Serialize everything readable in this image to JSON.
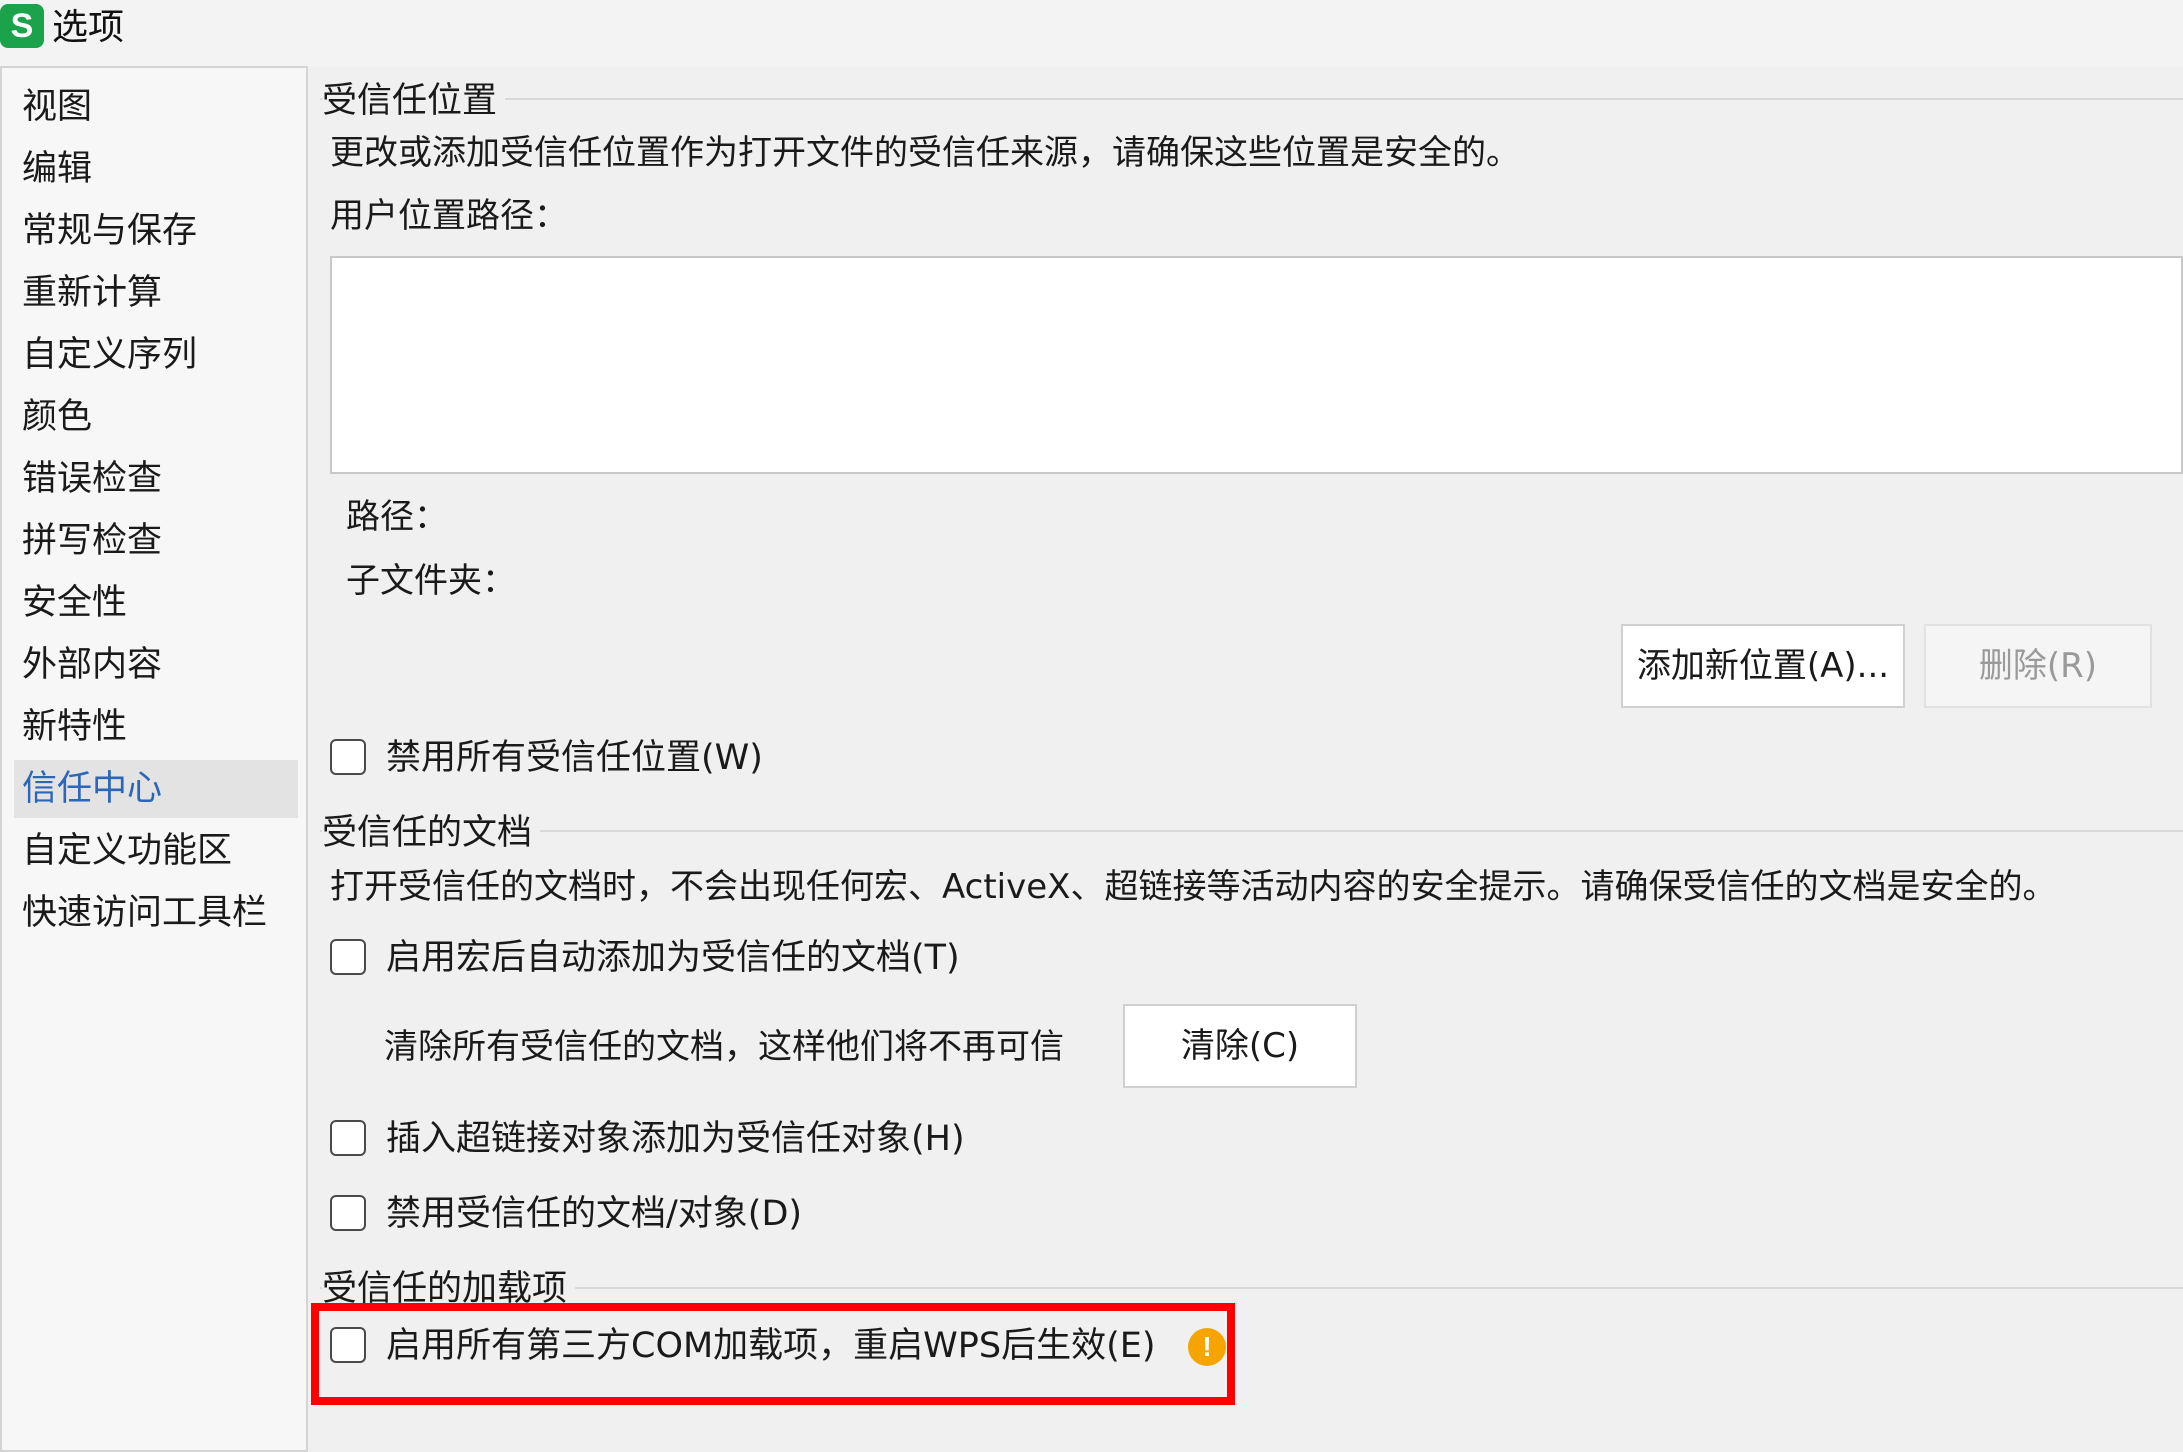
{
  "window": {
    "title": "选项",
    "logo_letter": "S"
  },
  "sidebar": {
    "items": [
      {
        "label": "视图"
      },
      {
        "label": "编辑"
      },
      {
        "label": "常规与保存"
      },
      {
        "label": "重新计算"
      },
      {
        "label": "自定义序列"
      },
      {
        "label": "颜色"
      },
      {
        "label": "错误检查"
      },
      {
        "label": "拼写检查"
      },
      {
        "label": "安全性"
      },
      {
        "label": "外部内容"
      },
      {
        "label": "新特性"
      },
      {
        "label": "信任中心",
        "active": true
      },
      {
        "label": "自定义功能区"
      },
      {
        "label": "快速访问工具栏"
      }
    ]
  },
  "trusted_locations": {
    "title": "受信任位置",
    "description": "更改或添加受信任位置作为打开文件的受信任来源，请确保这些位置是安全的。",
    "user_path_label": "用户位置路径：",
    "path_label": "路径：",
    "subfolder_label": "子文件夹：",
    "add_button": "添加新位置(A)...",
    "delete_button": "删除(R)",
    "disable_all_checkbox": "禁用所有受信任位置(W)"
  },
  "trusted_documents": {
    "title": "受信任的文档",
    "description": "打开受信任的文档时，不会出现任何宏、ActiveX、超链接等活动内容的安全提示。请确保受信任的文档是安全的。",
    "auto_add_checkbox": "启用宏后自动添加为受信任的文档(T)",
    "clear_text": "清除所有受信任的文档，这样他们将不再可信",
    "clear_button": "清除(C)",
    "hyperlink_checkbox": "插入超链接对象添加为受信任对象(H)",
    "disable_checkbox": "禁用受信任的文档/对象(D)"
  },
  "trusted_addins": {
    "title": "受信任的加载项",
    "com_checkbox": "启用所有第三方COM加载项，重启WPS后生效(E)",
    "warn_symbol": "!"
  },
  "colors": {
    "accent": "#2c66b9",
    "warning": "#f5a400",
    "highlight": "#ff0000",
    "logo": "#1aa34a"
  }
}
